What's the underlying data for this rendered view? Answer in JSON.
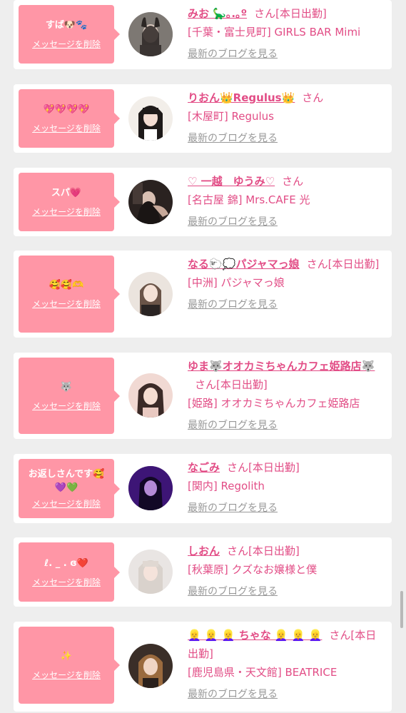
{
  "delete_label": "メッセージを削除",
  "san_label": "さん",
  "blog_label": "最新のブログを見る",
  "colors": {
    "accent": "#e24d86",
    "bubble": "#ff96a6",
    "background": "#eeeeee"
  },
  "items": [
    {
      "message": "すば🐶🐾",
      "name": "みお 🦕｡.｡º",
      "status": "[本日出勤]",
      "shop": "[千葉・富士見町] GIRLS BAR Mimi",
      "avatar_icon": "girl-photo-bunny-ears"
    },
    {
      "message": "💖💖💖💖",
      "name": "りおん👑Regulus👑",
      "status": "",
      "shop": "[木屋町] Regulus",
      "avatar_icon": "girl-photo-bangs"
    },
    {
      "message": "スパ💗",
      "name": "♡ 一越　ゆうみ♡",
      "status": "",
      "shop": "[名古屋 錦] Mrs.CAFE 光",
      "avatar_icon": "girl-photo-dark-room"
    },
    {
      "message": "🥰🥰🫶",
      "name": "なる🐑💭パジャマっ娘",
      "status": "[本日出勤]",
      "shop": "[中洲] パジャマっ娘",
      "avatar_icon": "girl-photo-light"
    },
    {
      "message": "🐺",
      "name": "ゆま🐺オオカミちゃんカフェ姫路店🐺",
      "status": "[本日出勤]",
      "shop": "[姫路] オオカミちゃんカフェ姫路店",
      "avatar_icon": "girl-photo-pink"
    },
    {
      "message": "お返しさんです🥰💜💚",
      "name": "なごみ",
      "status": "[本日出勤]",
      "shop": "[関内] Regolith",
      "avatar_icon": "girl-photo-purple"
    },
    {
      "message": "ℓ. _ . ɞ❤️",
      "name": "しおん",
      "status": "[本日出勤]",
      "shop": "[秋葉原] クズなお嬢様と僕",
      "avatar_icon": "girl-photo-blonde"
    },
    {
      "message": "✨",
      "name": "👱‍♀️ 👱‍♀️ 👱‍♀️ ちゃな 👱‍♀️ 👱‍♀️ 👱‍♀️",
      "status": "[本日出勤]",
      "shop": "[鹿児島県・天文館] BEATRICE",
      "avatar_icon": "girl-photo-brown"
    }
  ]
}
